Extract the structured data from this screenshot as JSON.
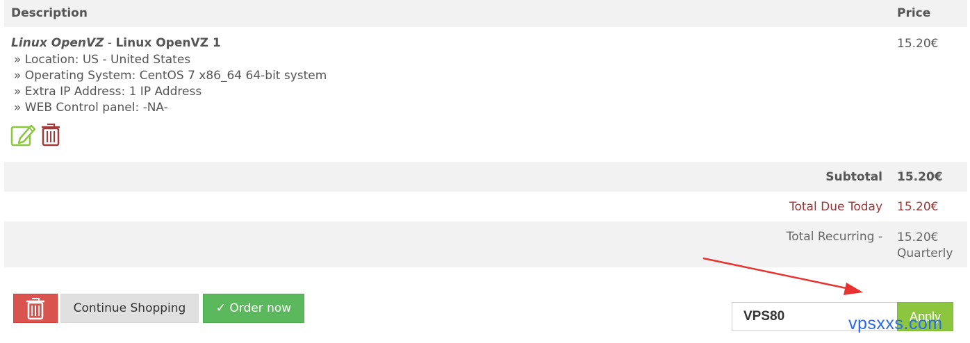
{
  "table": {
    "header": {
      "description": "Description",
      "price": "Price"
    }
  },
  "item": {
    "group": "Linux OpenVZ",
    "separator": " - ",
    "name": "Linux OpenVZ 1",
    "options": [
      "» Location: US - United States",
      "» Operating System: CentOS 7 x86_64 64-bit system",
      "» Extra IP Address: 1 IP Address",
      "» WEB Control panel: -NA-"
    ],
    "price": "15.20€",
    "icons": {
      "edit": "edit-icon",
      "remove": "trash-icon"
    }
  },
  "totals": {
    "subtotal_label": "Subtotal",
    "subtotal_value": "15.20€",
    "due_today_label": "Total Due Today",
    "due_today_value": "15.20€",
    "recurring_label": "Total Recurring -",
    "recurring_value": "15.20€",
    "recurring_cycle": "Quarterly"
  },
  "actions": {
    "empty_cart_icon": "trash-icon",
    "continue_label": "Continue Shopping",
    "order_label": "✓ Order now"
  },
  "promo": {
    "code": "VPS80",
    "apply_label": "Apply"
  },
  "watermark": "vpsxxs.com",
  "colors": {
    "header_bg": "#f2f2f2",
    "due_text": "#9b3434",
    "danger": "#d9534f",
    "success": "#5cb85c",
    "apply": "#8cc63f",
    "arrow": "#e8322f",
    "watermark": "#2a68f4"
  }
}
